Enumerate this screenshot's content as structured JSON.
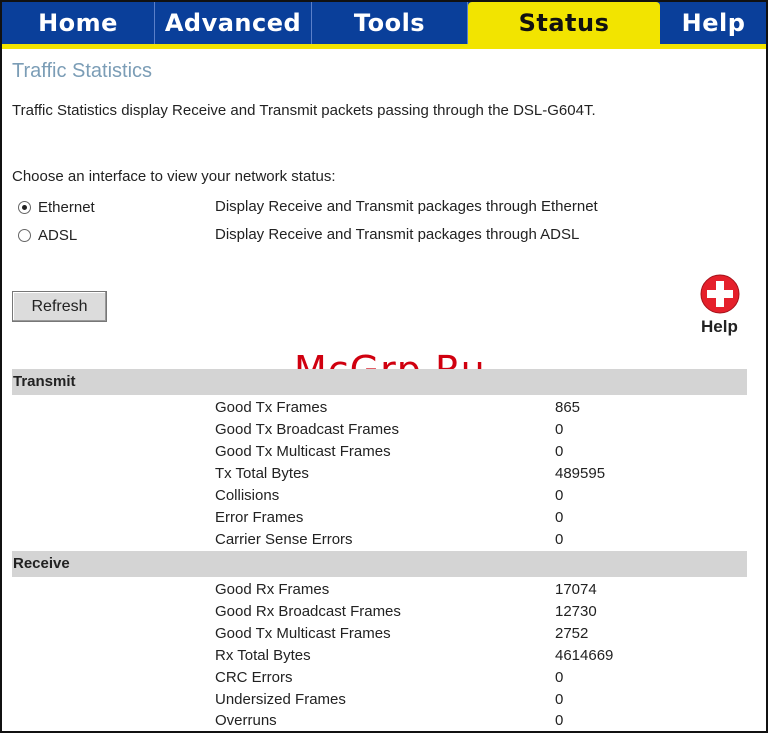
{
  "tabs": [
    {
      "label": "Home",
      "active": false
    },
    {
      "label": "Advanced",
      "active": false
    },
    {
      "label": "Tools",
      "active": false
    },
    {
      "label": "Status",
      "active": true
    },
    {
      "label": "Help",
      "active": false
    }
  ],
  "colors": {
    "tab_bar": "#0a3f9a",
    "active_tab": "#f2e400",
    "section_bar": "#d4d4d4",
    "title": "#7b9db6",
    "watermark": "#d0000f",
    "help_icon": "#e5202b"
  },
  "page": {
    "title": "Traffic Statistics",
    "description": "Traffic Statistics display Receive and Transmit packets passing through the DSL-G604T.",
    "choose_label": "Choose an interface to view your network status:"
  },
  "interfaces": [
    {
      "label": "Ethernet",
      "description": "Display Receive and Transmit packages through Ethernet",
      "selected": true
    },
    {
      "label": "ADSL",
      "description": "Display Receive and Transmit packages through ADSL",
      "selected": false
    }
  ],
  "refresh_label": "Refresh",
  "help": {
    "label": "Help",
    "icon": "plus-circle-icon"
  },
  "watermark": "McGrp.Ru",
  "transmit": {
    "heading": "Transmit",
    "rows": [
      {
        "label": "Good Tx Frames",
        "value": "865"
      },
      {
        "label": "Good Tx Broadcast Frames",
        "value": "0"
      },
      {
        "label": "Good Tx Multicast Frames",
        "value": "0"
      },
      {
        "label": "Tx Total Bytes",
        "value": "489595"
      },
      {
        "label": "Collisions",
        "value": "0"
      },
      {
        "label": "Error Frames",
        "value": "0"
      },
      {
        "label": "Carrier Sense Errors",
        "value": "0"
      }
    ]
  },
  "receive": {
    "heading": "Receive",
    "rows": [
      {
        "label": "Good Rx Frames",
        "value": "17074"
      },
      {
        "label": "Good Rx Broadcast Frames",
        "value": "12730"
      },
      {
        "label": "Good Tx Multicast Frames",
        "value": "2752"
      },
      {
        "label": "Rx Total Bytes",
        "value": "4614669"
      },
      {
        "label": "CRC Errors",
        "value": "0"
      },
      {
        "label": "Undersized Frames",
        "value": "0"
      },
      {
        "label": "Overruns",
        "value": "0"
      }
    ]
  }
}
